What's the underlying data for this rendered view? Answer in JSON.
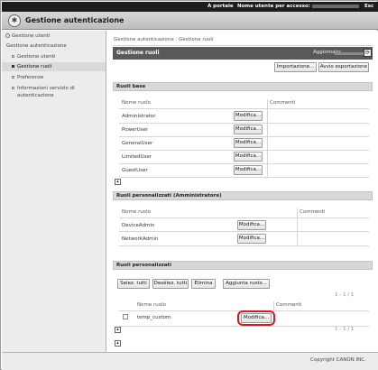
{
  "topbar": {
    "portal_link": "A portale",
    "user_label": "Nome utente per accesso:",
    "user_value_masked": true,
    "tail_text": "Esc"
  },
  "app": {
    "title": "Gestione autenticazione"
  },
  "sidebar": {
    "top_link": "Gestione utenti",
    "section_title": "Gestione autenticazione",
    "items": [
      {
        "label": "Gestione utenti",
        "selected": false
      },
      {
        "label": "Gestione ruoli",
        "selected": true
      },
      {
        "label": "Preferenze",
        "selected": false
      },
      {
        "label": "Informazioni servizio di",
        "label2": "autenticazione",
        "selected": false
      }
    ]
  },
  "main": {
    "breadcrumb": "Gestione autenticazione : Gestione ruoli",
    "page_title": "Gestione ruoli",
    "updated_label": "Aggiornato:",
    "buttons": {
      "import": "Importazione...",
      "export": "Avvio esportazione"
    },
    "base_roles": {
      "title": "Ruoli base",
      "col_name": "Nome ruolo",
      "col_comments": "Commenti",
      "rows": [
        {
          "name": "Administrator",
          "action": "Modifica..."
        },
        {
          "name": "PowerUser",
          "action": "Modifica..."
        },
        {
          "name": "GeneralUser",
          "action": "Modifica..."
        },
        {
          "name": "LimitedUser",
          "action": "Modifica..."
        },
        {
          "name": "GuestUser",
          "action": "Modifica..."
        }
      ]
    },
    "admin_roles": {
      "title": "Ruoli personalizzati (Amministratore)",
      "col_name": "Nome ruolo",
      "col_comments": "Commenti",
      "rows": [
        {
          "name": "DeviceAdmin",
          "action": "Modifica..."
        },
        {
          "name": "NetworkAdmin",
          "action": "Modifica..."
        }
      ]
    },
    "custom_roles": {
      "title": "Ruoli personalizzati",
      "buttons": {
        "select_all": "Selez. tutti",
        "deselect_all": "Desélez. tutti",
        "delete": "Elimina",
        "add": "Aggiunta ruolo..."
      },
      "pager_top": "1 - 1 / 1",
      "pager_bottom": "1 - 1 / 1",
      "col_name": "Nome ruolo",
      "col_comments": "Commenti",
      "rows": [
        {
          "name": "temp_custom",
          "action": "Modifica...",
          "checked": false
        }
      ]
    }
  },
  "footer": {
    "copyright": "Copyright CANON INC."
  },
  "colors": {
    "topbar": "#1d1d1d",
    "header_dark": "#595959",
    "section_bg": "#d8d8d8",
    "highlight": "#e0151b"
  }
}
